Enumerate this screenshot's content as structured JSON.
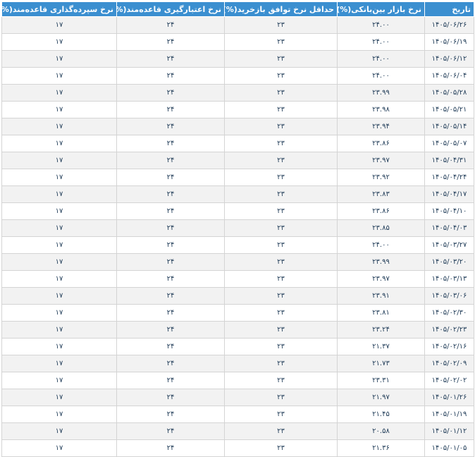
{
  "table": {
    "headers": [
      "تاریخ",
      "نرخ بازار بین‌بانکی(%)",
      "حداقل نرخ توافق بازخرید(%)",
      "نرخ اعتبارگیری قاعده‌مند(%)",
      "نرخ سپرده‌گذاری قاعده‌مند(%)"
    ],
    "rows": [
      [
        "۱۴۰۵/۰۶/۲۶",
        "۲۴.۰۰",
        "۲۳",
        "۲۴",
        "۱۷"
      ],
      [
        "۱۴۰۵/۰۶/۱۹",
        "۲۴.۰۰",
        "۲۳",
        "۲۴",
        "۱۷"
      ],
      [
        "۱۴۰۵/۰۶/۱۲",
        "۲۴.۰۰",
        "۲۳",
        "۲۴",
        "۱۷"
      ],
      [
        "۱۴۰۵/۰۶/۰۴",
        "۲۴.۰۰",
        "۲۳",
        "۲۴",
        "۱۷"
      ],
      [
        "۱۴۰۵/۰۵/۲۸",
        "۲۳.۹۹",
        "۲۳",
        "۲۴",
        "۱۷"
      ],
      [
        "۱۴۰۵/۰۵/۲۱",
        "۲۳.۹۸",
        "۲۳",
        "۲۴",
        "۱۷"
      ],
      [
        "۱۴۰۵/۰۵/۱۴",
        "۲۳.۹۴",
        "۲۳",
        "۲۴",
        "۱۷"
      ],
      [
        "۱۴۰۵/۰۵/۰۷",
        "۲۳.۸۶",
        "۲۳",
        "۲۴",
        "۱۷"
      ],
      [
        "۱۴۰۵/۰۴/۳۱",
        "۲۳.۹۷",
        "۲۳",
        "۲۴",
        "۱۷"
      ],
      [
        "۱۴۰۵/۰۴/۲۴",
        "۲۳.۹۲",
        "۲۳",
        "۲۴",
        "۱۷"
      ],
      [
        "۱۴۰۵/۰۴/۱۷",
        "۲۳.۸۳",
        "۲۳",
        "۲۴",
        "۱۷"
      ],
      [
        "۱۴۰۵/۰۴/۱۰",
        "۲۳.۸۶",
        "۲۳",
        "۲۴",
        "۱۷"
      ],
      [
        "۱۴۰۵/۰۴/۰۳",
        "۲۳.۸۵",
        "۲۳",
        "۲۴",
        "۱۷"
      ],
      [
        "۱۴۰۵/۰۳/۲۷",
        "۲۴.۰۰",
        "۲۳",
        "۲۴",
        "۱۷"
      ],
      [
        "۱۴۰۵/۰۳/۲۰",
        "۲۳.۹۹",
        "۲۳",
        "۲۴",
        "۱۷"
      ],
      [
        "۱۴۰۵/۰۳/۱۳",
        "۲۳.۹۷",
        "۲۳",
        "۲۴",
        "۱۷"
      ],
      [
        "۱۴۰۵/۰۳/۰۶",
        "۲۳.۹۱",
        "۲۳",
        "۲۴",
        "۱۷"
      ],
      [
        "۱۴۰۵/۰۲/۳۰",
        "۲۳.۸۱",
        "۲۳",
        "۲۴",
        "۱۷"
      ],
      [
        "۱۴۰۵/۰۲/۲۳",
        "۲۳.۲۴",
        "۲۳",
        "۲۴",
        "۱۷"
      ],
      [
        "۱۴۰۵/۰۲/۱۶",
        "۲۱.۳۷",
        "۲۳",
        "۲۴",
        "۱۷"
      ],
      [
        "۱۴۰۵/۰۲/۰۹",
        "۲۱.۷۳",
        "۲۳",
        "۲۴",
        "۱۷"
      ],
      [
        "۱۴۰۵/۰۲/۰۲",
        "۲۳.۳۱",
        "۲۳",
        "۲۴",
        "۱۷"
      ],
      [
        "۱۴۰۵/۰۱/۲۶",
        "۲۱.۹۷",
        "۲۳",
        "۲۴",
        "۱۷"
      ],
      [
        "۱۴۰۵/۰۱/۱۹",
        "۲۱.۴۵",
        "۲۳",
        "۲۴",
        "۱۷"
      ],
      [
        "۱۴۰۵/۰۱/۱۲",
        "۲۰.۵۸",
        "۲۳",
        "۲۴",
        "۱۷"
      ],
      [
        "۱۴۰۵/۰۱/۰۵",
        "۲۱.۳۶",
        "۲۳",
        "۲۴",
        "۱۷"
      ]
    ]
  },
  "colors": {
    "header_bg": "#3b8fd0",
    "header_text": "#ffffff",
    "row_stripe": "#f2f2f2",
    "cell_text": "#1f3b57"
  }
}
